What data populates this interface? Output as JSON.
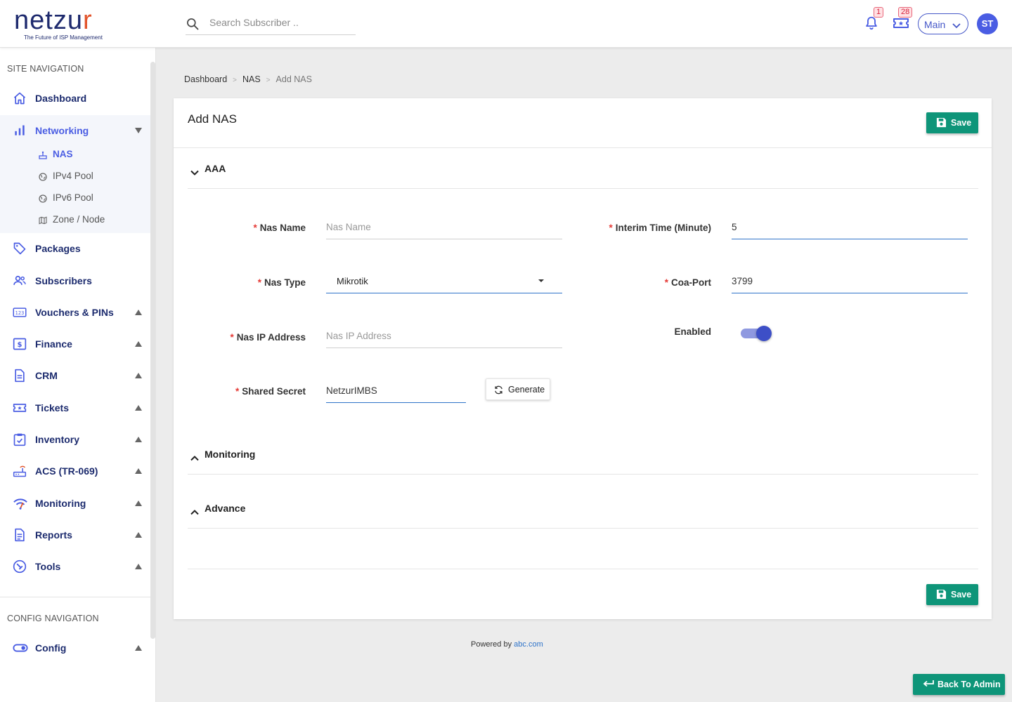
{
  "header": {
    "logo_text_main": "netzu",
    "logo_text_accent": "r",
    "logo_tagline": "The Future of ISP Management",
    "search_placeholder": "Search Subscriber ..",
    "notifications_count": "1",
    "tickets_count": "28",
    "workspace_select": "Main",
    "avatar_initials": "ST"
  },
  "sidebar": {
    "site_heading": "SITE NAVIGATION",
    "config_heading": "CONFIG NAVIGATION",
    "items": [
      {
        "label": "Dashboard",
        "icon": "home-icon"
      },
      {
        "label": "Networking",
        "icon": "bar-chart-icon"
      },
      {
        "label": "Packages",
        "icon": "tag-icon"
      },
      {
        "label": "Subscribers",
        "icon": "users-icon"
      },
      {
        "label": "Vouchers & PINs",
        "icon": "numeric-icon"
      },
      {
        "label": "Finance",
        "icon": "dollar-icon"
      },
      {
        "label": "CRM",
        "icon": "document-icon"
      },
      {
        "label": "Tickets",
        "icon": "ticket-icon"
      },
      {
        "label": "Inventory",
        "icon": "clipboard-check-icon"
      },
      {
        "label": "ACS (TR-069)",
        "icon": "router-icon"
      },
      {
        "label": "Monitoring",
        "icon": "wifi-icon"
      },
      {
        "label": "Reports",
        "icon": "report-icon"
      },
      {
        "label": "Tools",
        "icon": "tools-icon"
      },
      {
        "label": "Config",
        "icon": "toggle-icon"
      }
    ],
    "networking_sub": [
      {
        "label": "NAS",
        "icon": "nas-icon"
      },
      {
        "label": "IPv4 Pool",
        "icon": "globe-icon"
      },
      {
        "label": "IPv6 Pool",
        "icon": "globe-icon"
      },
      {
        "label": "Zone / Node",
        "icon": "map-icon"
      }
    ]
  },
  "breadcrumb": {
    "items": [
      "Dashboard",
      "NAS",
      "Add NAS"
    ],
    "separator": ">"
  },
  "card": {
    "title": "Add NAS",
    "save_label": "Save",
    "sections": {
      "aaa": "AAA",
      "monitoring": "Monitoring",
      "advance": "Advance"
    },
    "fields": {
      "nas_name": {
        "label": "Nas Name",
        "placeholder": "Nas Name",
        "value": ""
      },
      "nas_type": {
        "label": "Nas Type",
        "value": "Mikrotik"
      },
      "nas_ip": {
        "label": "Nas IP Address",
        "placeholder": "Nas IP Address",
        "value": ""
      },
      "shared_secret": {
        "label": "Shared Secret",
        "value": "NetzurIMBS"
      },
      "interim_time": {
        "label": "Interim Time (Minute)",
        "value": "5"
      },
      "coa_port": {
        "label": "Coa-Port",
        "value": "3799"
      },
      "enabled": {
        "label": "Enabled",
        "value": "on"
      }
    },
    "required_mark": "*",
    "generate_label": "Generate"
  },
  "footer": {
    "powered_text": "Powered by",
    "powered_link": "abc.com",
    "back_label": "Back To Admin"
  },
  "colors": {
    "primary": "#4a5de3",
    "nav_text": "#1c2b6e",
    "save_green": "#0e9579",
    "required_red": "#e53935",
    "logo_accent": "#e2542b"
  }
}
